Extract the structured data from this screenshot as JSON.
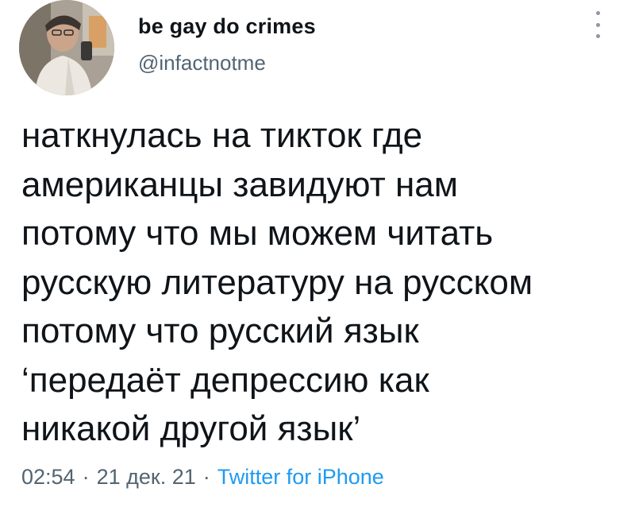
{
  "author": {
    "display_name": "be gay do crimes",
    "handle": "@infactnotme",
    "avatar_icon": "profile-photo-avatar"
  },
  "menu": {
    "icon": "more-vertical-icon"
  },
  "tweet": {
    "lines": [
      "наткнулась на тикток где",
      "американцы завидуют нам",
      "потому что мы можем читать",
      "русскую литературу на русском",
      "потому что русский язык",
      "‘передаёт депрессию как",
      "никакой другой язык’"
    ]
  },
  "meta": {
    "time": "02:54",
    "separator": "·",
    "date": "21 дек. 21",
    "source": "Twitter for iPhone"
  },
  "colors": {
    "text_primary": "#0f1419",
    "text_secondary": "#536471",
    "link": "#1d9bf0",
    "background": "#ffffff"
  }
}
